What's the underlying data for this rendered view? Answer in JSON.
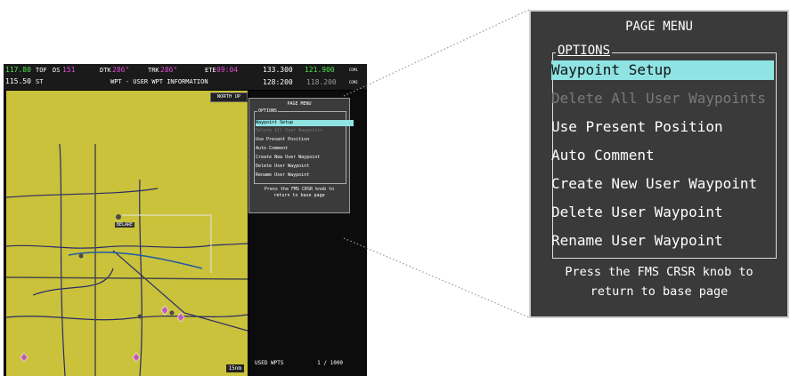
{
  "header": {
    "com_active": "117.80",
    "com_standby": "115.50",
    "tof": "TOF",
    "st": "ST",
    "ds_label": "DS",
    "ds_value": "151",
    "dtk_label": "DTK",
    "dtk_value": "286°",
    "trk_label": "TRK",
    "trk_value": "286°",
    "ete_label": "ETE",
    "ete_value": "09:04",
    "page_title": "WPT - USER WPT INFORMATION",
    "nav_active": "133.300",
    "nav_standby": "121.900",
    "nav2_active": "128:200",
    "nav2_standby": "118.200",
    "com1": "COM1",
    "com2": "COM2"
  },
  "map": {
    "north_up": "NORTH UP",
    "belare_label": "BELARE",
    "scale": "15nm"
  },
  "small_menu": {
    "title": "PAGE MENU",
    "options_header": "OPTIONS",
    "items": [
      "Waypoint Setup",
      "Delete All User Waypoints",
      "Use Present Position",
      "Auto Comment",
      "Create New User Waypoint",
      "Delete User Waypoint",
      "Rename User Waypoint"
    ],
    "footer_line1": "Press the FMS CRSR knob to",
    "footer_line2": "return to base page"
  },
  "used_wpts": {
    "label": "USED WPTS",
    "value": "1 / 1000"
  },
  "page_menu": {
    "title": "PAGE MENU",
    "options_header": "OPTIONS",
    "items": [
      {
        "label": "Waypoint Setup",
        "state": "selected"
      },
      {
        "label": "Delete All User Waypoints",
        "state": "disabled"
      },
      {
        "label": "Use Present Position",
        "state": "enabled"
      },
      {
        "label": "Auto Comment",
        "state": "enabled"
      },
      {
        "label": "Create New User Waypoint",
        "state": "enabled"
      },
      {
        "label": "Delete User Waypoint",
        "state": "enabled"
      },
      {
        "label": "Rename User Waypoint",
        "state": "enabled"
      }
    ],
    "footer_line1": "Press the FMS CRSR knob to",
    "footer_line2": "return to base page"
  },
  "colors": {
    "highlight": "#8fe3e3",
    "menu_bg": "#3a3a3a",
    "map_bg": "#c9c23a",
    "cyan": "#3fd7e6",
    "magenta": "#e04dd6"
  }
}
